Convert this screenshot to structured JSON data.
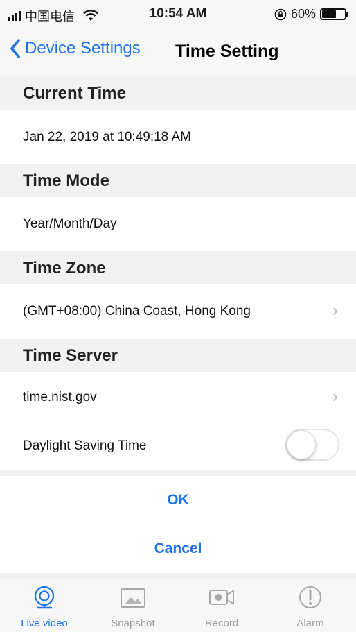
{
  "status_bar": {
    "carrier": "中国电信",
    "time": "10:54 AM",
    "battery_text": "60%",
    "battery_level": 0.6
  },
  "nav": {
    "back_label": "Device Settings",
    "title": "Time Setting"
  },
  "sections": {
    "current_time": {
      "header": "Current Time",
      "value": "Jan 22, 2019 at 10:49:18 AM"
    },
    "time_mode": {
      "header": "Time Mode",
      "value": "Year/Month/Day"
    },
    "time_zone": {
      "header": "Time Zone",
      "value": "(GMT+08:00) China Coast, Hong Kong"
    },
    "time_server": {
      "header": "Time Server",
      "value": "time.nist.gov",
      "dst_label": "Daylight Saving Time",
      "dst_enabled": false
    }
  },
  "buttons": {
    "ok": "OK",
    "cancel": "Cancel"
  },
  "tabs": [
    {
      "label": "Live video",
      "icon": "live-video-icon",
      "active": true
    },
    {
      "label": "Snapshot",
      "icon": "snapshot-icon",
      "active": false
    },
    {
      "label": "Record",
      "icon": "record-icon",
      "active": false
    },
    {
      "label": "Alarm",
      "icon": "alarm-icon",
      "active": false
    }
  ],
  "colors": {
    "accent": "#1a73e8",
    "tab_inactive": "#9b9b9b",
    "section_bg": "#f2f2f2"
  }
}
